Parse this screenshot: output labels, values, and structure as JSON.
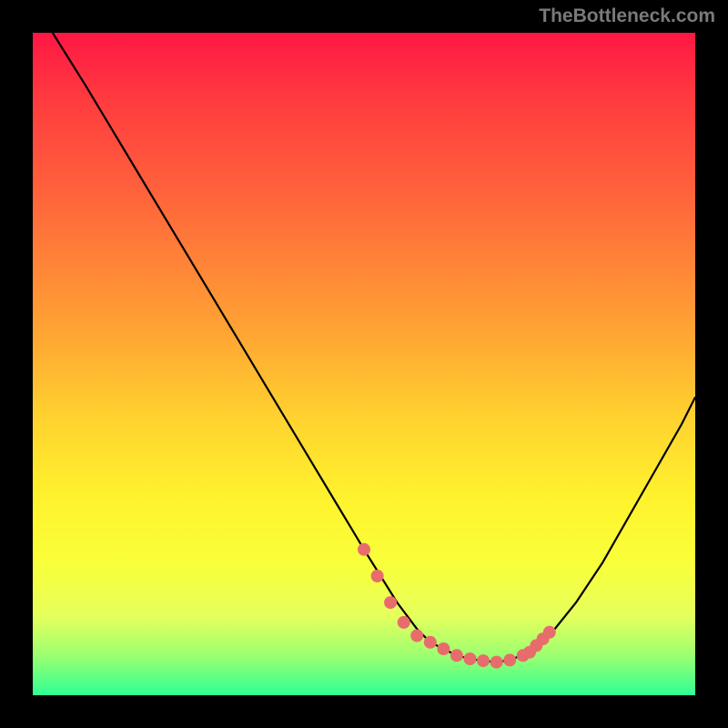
{
  "watermark": "TheBottleneck.com",
  "chart_data": {
    "type": "line",
    "title": "",
    "xlabel": "",
    "ylabel": "",
    "xlim": [
      0,
      100
    ],
    "ylim": [
      0,
      100
    ],
    "grid": false,
    "series": [
      {
        "name": "curve",
        "x": [
          3,
          8,
          14,
          20,
          26,
          32,
          38,
          44,
          50,
          55,
          58,
          60,
          62,
          64,
          66,
          68,
          70,
          72,
          75,
          78,
          82,
          86,
          90,
          94,
          98,
          100
        ],
        "y": [
          100,
          92,
          82,
          72,
          62,
          52,
          42,
          32,
          22,
          14,
          10,
          8,
          7,
          6,
          5.5,
          5.2,
          5,
          5.3,
          6.5,
          9,
          14,
          20,
          27,
          34,
          41,
          45
        ]
      }
    ],
    "markers": {
      "name": "highlight-points",
      "color": "#e86c6c",
      "x": [
        50,
        52,
        54,
        56,
        58,
        60,
        62,
        64,
        66,
        68,
        70,
        72,
        74,
        75,
        76,
        77,
        78
      ],
      "y": [
        22,
        18,
        14,
        11,
        9,
        8,
        7,
        6,
        5.5,
        5.2,
        5,
        5.3,
        6,
        6.5,
        7.5,
        8.5,
        9.5
      ]
    }
  }
}
